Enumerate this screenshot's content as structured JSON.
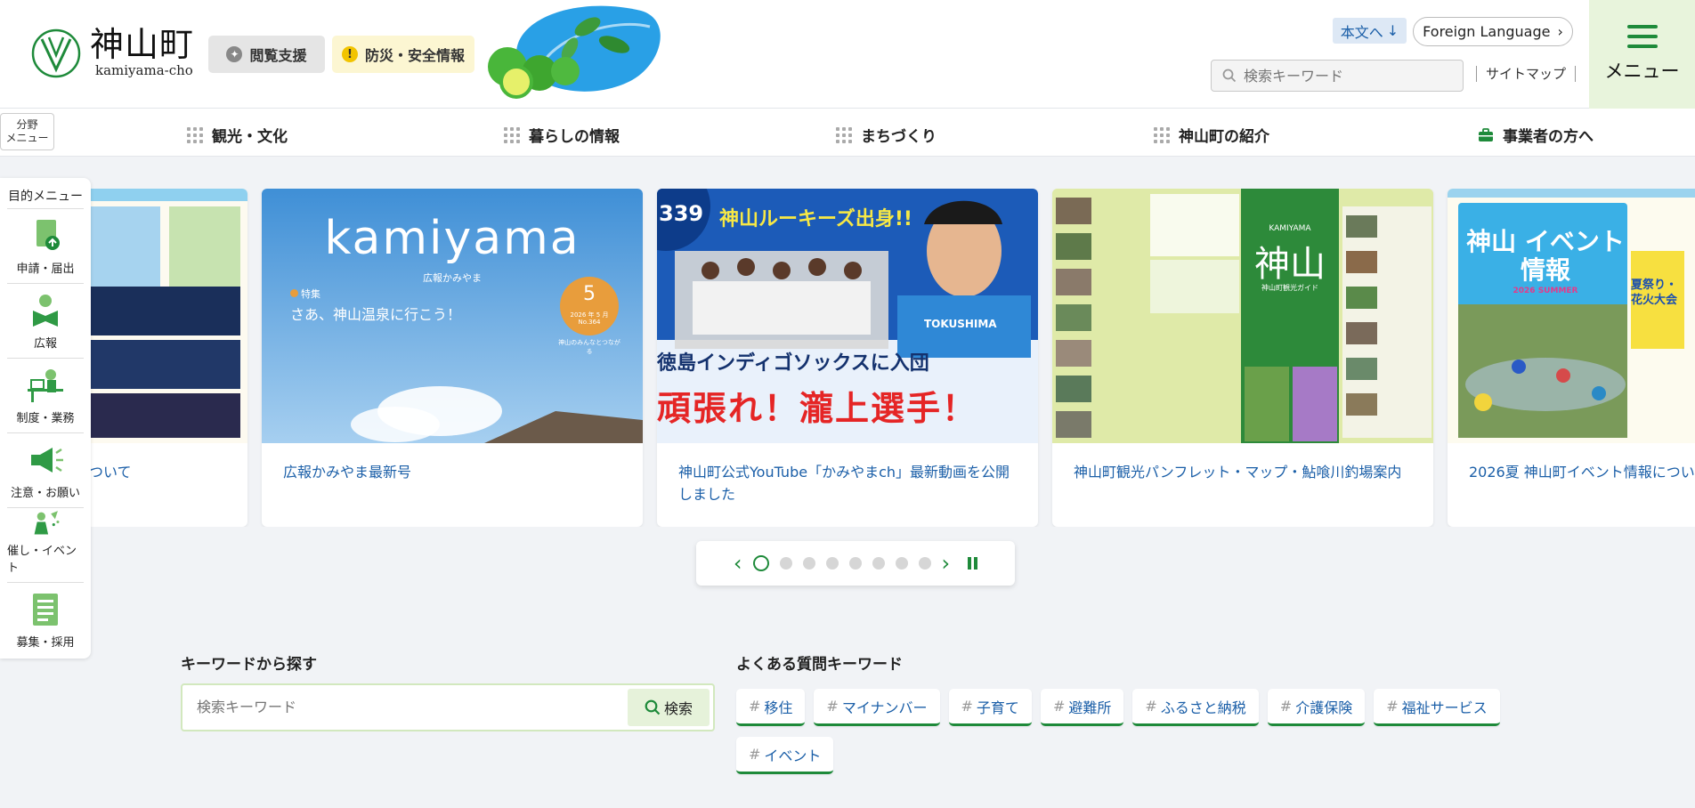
{
  "header": {
    "logo_ja": "神山町",
    "logo_en": "kamiyama-cho",
    "access_label": "閲覧支援",
    "disaster_label": "防災・安全情報",
    "skip_label": "本文へ",
    "foreign_label": "Foreign Language",
    "search_placeholder": "検索キーワード",
    "sitemap_label": "サイトマップ",
    "menu_label": "メニュー"
  },
  "nav": {
    "field_menu": "分野\nメニュー",
    "items": [
      "観光・文化",
      "暮らしの情報",
      "まちづくり",
      "神山町の紹介",
      "事業者の方へ"
    ]
  },
  "side_menu": {
    "title": "目的メニュー",
    "items": [
      {
        "label": "申請・届出",
        "icon": "document-upload-icon"
      },
      {
        "label": "広報",
        "icon": "reading-person-icon"
      },
      {
        "label": "制度・業務",
        "icon": "desk-worker-icon"
      },
      {
        "label": "注意・お願い",
        "icon": "megaphone-icon"
      },
      {
        "label": "催し・イベント",
        "icon": "party-icon"
      },
      {
        "label": "募集・採用",
        "icon": "notice-board-icon"
      }
    ]
  },
  "carousel": {
    "cards": [
      {
        "caption": "ついて"
      },
      {
        "caption": "広報かみやま最新号",
        "title": "kamiyama",
        "subtitle": "広報かみやま",
        "feature_tag": "特集",
        "feature_text": "さあ、神山温泉に行こう！",
        "issue_number": "5",
        "issue_date": "2026 年 5 月",
        "issue_no": "No.364",
        "issue_tagline": "神山のみんなとつながる"
      },
      {
        "caption": "神山町公式YouTube「かみやまch」最新動画を公開しました",
        "episode": "339",
        "headline": "神山ルーキーズ出身!!",
        "team": "徳島インディゴソックスに入団",
        "cheer": "頑張れ！瀧上選手！",
        "jersey": "TOKUSHIMA"
      },
      {
        "caption": "神山町観光パンフレット・マップ・鮎喰川釣場案内",
        "brand": "KAMIYAMA",
        "title": "神山",
        "subtitle": "神山町観光ガイド"
      },
      {
        "caption": "2026夏 神山町イベント情報につい",
        "title": "神山 イベント情報",
        "season": "2026 SUMMER",
        "side_text": "夏祭り・花火大会"
      }
    ],
    "dots": 8,
    "active_dot": 0
  },
  "keyword": {
    "title": "キーワードから探す",
    "placeholder": "検索キーワード",
    "button": "検索"
  },
  "faq": {
    "title": "よくある質問キーワード",
    "tags": [
      "移住",
      "マイナンバー",
      "子育て",
      "避難所",
      "ふるさと納税",
      "介護保険",
      "福祉サービス",
      "イベント"
    ]
  },
  "colors": {
    "green": "#1e8a3a",
    "link": "#1b5fa8",
    "menu_bg": "#e8f4dc"
  }
}
